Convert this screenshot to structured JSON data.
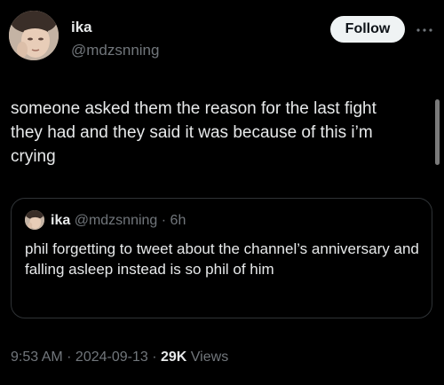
{
  "author": {
    "display_name": "ika",
    "handle": "@mdzsnning",
    "avatar_icon": "profile-avatar"
  },
  "follow_button_label": "Follow",
  "more_icon": "ellipsis-icon",
  "tweet_text": "someone asked them the reason for the last fight\nthey had and they said it was because of this i’m\ncrying",
  "quoted_tweet": {
    "display_name": "ika",
    "handle": "@mdzsnning",
    "separator": " · ",
    "time": "6h",
    "text": "phil forgetting to tweet about the channel’s anniversary and falling asleep instead is so phil of him"
  },
  "meta": {
    "time": "9:53 AM",
    "separator": " · ",
    "date": "2024-09-13",
    "views_count": "29K",
    "views_label": "Views"
  },
  "colors": {
    "background": "#000000",
    "text_primary": "#e7e9ea",
    "text_secondary": "#71767b",
    "border": "#2f3336",
    "button_bg": "#eff3f4"
  }
}
